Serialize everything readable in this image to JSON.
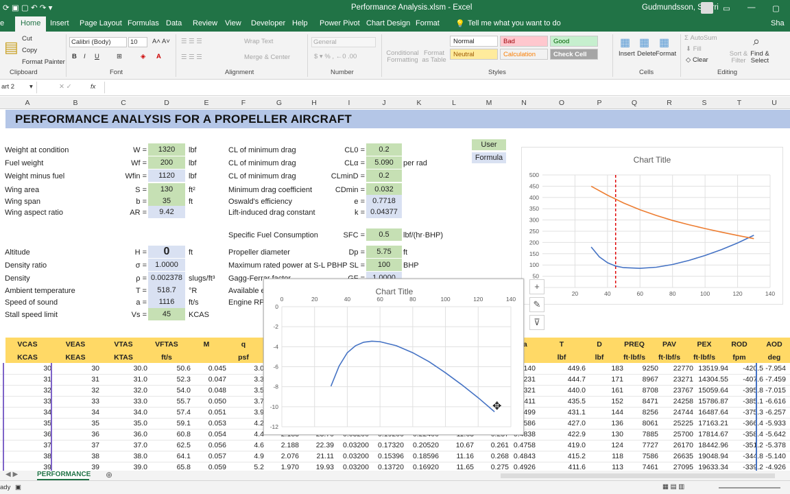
{
  "window": {
    "title": "Performance Analysis.xlsm  -  Excel",
    "user": "Gudmundsson, Snorri"
  },
  "tabs": [
    "Home",
    "Insert",
    "Page Layout",
    "Formulas",
    "Data",
    "Review",
    "View",
    "Developer",
    "Help",
    "Power Pivot",
    "Chart Design",
    "Format"
  ],
  "tell_me": "Tell me what you want to do",
  "share": "Sha",
  "ribbon": {
    "clipboard": {
      "cut": "Cut",
      "copy": "Copy",
      "painter": "Format Painter",
      "group": "Clipboard"
    },
    "font": {
      "name": "Calibri (Body)",
      "size": "10",
      "group": "Font"
    },
    "alignment": {
      "wrap": "Wrap Text",
      "merge": "Merge & Center",
      "group": "Alignment"
    },
    "number": {
      "format": "General",
      "group": "Number"
    },
    "styles": {
      "cond": "Conditional Formatting",
      "table": "Format as Table",
      "normal": "Normal",
      "bad": "Bad",
      "good": "Good",
      "neutral": "Neutral",
      "calc": "Calculation",
      "check": "Check Cell",
      "group": "Styles"
    },
    "cells": {
      "insert": "Insert",
      "delete": "Delete",
      "format": "Format",
      "group": "Cells"
    },
    "editing": {
      "autosum": "AutoSum",
      "fill": "Fill",
      "clear": "Clear",
      "sort": "Sort & Filter",
      "find": "Find & Select",
      "group": "Editing"
    }
  },
  "namebox": "art 2",
  "fx": "fx",
  "columns": [
    "A",
    "B",
    "C",
    "D",
    "E",
    "F",
    "G",
    "H",
    "I",
    "J",
    "K",
    "L",
    "M",
    "N",
    "O",
    "P",
    "Q",
    "R",
    "S",
    "T",
    "U"
  ],
  "banner": "PERFORMANCE ANALYSIS FOR A PROPELLER AIRCRAFT",
  "params_left": [
    {
      "label": "Weight at condition",
      "sym": "W =",
      "val": "1320",
      "unit": "lbf",
      "cls": "in"
    },
    {
      "label": "Fuel weight",
      "sym": "Wf =",
      "val": "200",
      "unit": "lbf",
      "cls": "in"
    },
    {
      "label": "Weight minus fuel",
      "sym": "Wfin =",
      "val": "1120",
      "unit": "lbf",
      "cls": "fo"
    },
    {
      "label": "Wing area",
      "sym": "S =",
      "val": "130",
      "unit": "ft²",
      "cls": "in"
    },
    {
      "label": "Wing span",
      "sym": "b =",
      "val": "35",
      "unit": "ft",
      "cls": "in"
    },
    {
      "label": "Wing aspect ratio",
      "sym": "AR =",
      "val": "9.42",
      "unit": "",
      "cls": "fo"
    }
  ],
  "params_left2": [
    {
      "label": "Altitude",
      "sym": "H =",
      "val": "0",
      "unit": "ft",
      "cls": "fo"
    },
    {
      "label": "Density ratio",
      "sym": "σ =",
      "val": "1.0000",
      "unit": "",
      "cls": "fo"
    },
    {
      "label": "Density",
      "sym": "ρ =",
      "val": "0.002378",
      "unit": "slugs/ft³",
      "cls": "fo"
    },
    {
      "label": "Ambient temperature",
      "sym": "T =",
      "val": "518.7",
      "unit": "°R",
      "cls": "fo"
    },
    {
      "label": "Speed of sound",
      "sym": "a =",
      "val": "1116",
      "unit": "ft/s",
      "cls": "fo"
    },
    {
      "label": "Stall speed limit",
      "sym": "Vs =",
      "val": "45",
      "unit": "KCAS",
      "cls": "in"
    }
  ],
  "params_mid": [
    {
      "label": "CL of minimum drag",
      "sym": "CL0 =",
      "val": "0.2",
      "unit": "",
      "cls": "in"
    },
    {
      "label": "CL of minimum drag",
      "sym": "CLα =",
      "val": "5.090",
      "unit": "per rad",
      "cls": "in"
    },
    {
      "label": "CL of minimum drag",
      "sym": "CLminD =",
      "val": "0.2",
      "unit": "",
      "cls": "in"
    },
    {
      "label": "Minimum drag coefficient",
      "sym": "CDmin =",
      "val": "0.032",
      "unit": "",
      "cls": "in"
    },
    {
      "label": "Oswald's efficiency",
      "sym": "e =",
      "val": "0.7718",
      "unit": "",
      "cls": "fo"
    },
    {
      "label": "Lift-induced drag constant",
      "sym": "k =",
      "val": "0.04377",
      "unit": "",
      "cls": "fo"
    }
  ],
  "params_mid2": [
    {
      "label": "Specific Fuel Consumption",
      "sym": "SFC =",
      "val": "0.5",
      "unit": "lbf/(hr·BHP)",
      "cls": "in"
    },
    {
      "label": "Propeller diameter",
      "sym": "Dp =",
      "val": "5.75",
      "unit": "ft",
      "cls": "in"
    },
    {
      "label": "Maximum rated power at S-L",
      "sym": "PBHP SL =",
      "val": "100",
      "unit": "BHP",
      "cls": "in"
    },
    {
      "label": "Gagg-Ferrar factor",
      "sym": "GF =",
      "val": "1.0000",
      "unit": "",
      "cls": "fo"
    },
    {
      "label": "Available e",
      "sym": "",
      "val": "",
      "unit": "",
      "cls": ""
    },
    {
      "label": "Engine RPM",
      "sym": "",
      "val": "",
      "unit": "",
      "cls": ""
    }
  ],
  "legend": {
    "user": "User",
    "formula": "Formula"
  },
  "headers_top": [
    "VCAS",
    "VEAS",
    "VTAS",
    "VFTAS",
    "M",
    "q",
    "ta",
    "T",
    "D",
    "PREQ",
    "PAV",
    "PEX",
    "ROD",
    "AOD"
  ],
  "headers_unit": [
    "KCAS",
    "KEAS",
    "KTAS",
    "ft/s",
    "",
    "psf",
    "",
    "lbf",
    "lbf",
    "ft·lbf/s",
    "ft·lbf/s",
    "ft·lbf/s",
    "fpm",
    "deg"
  ],
  "rows": [
    [
      "30",
      "30",
      "30.0",
      "50.6",
      "0.045",
      "3.0",
      "",
      "",
      "",
      "",
      "",
      "",
      "",
      "140",
      "449.6",
      "183",
      "9250",
      "22770",
      "13519.94",
      "-420.5",
      "-7.954"
    ],
    [
      "31",
      "31",
      "31.0",
      "52.3",
      "0.047",
      "3.3",
      "",
      "",
      "",
      "",
      "",
      "",
      "",
      "231",
      "444.7",
      "171",
      "8967",
      "23271",
      "14304.55",
      "-407.6",
      "-7.459"
    ],
    [
      "32",
      "32",
      "32.0",
      "54.0",
      "0.048",
      "3.5",
      "",
      "",
      "",
      "",
      "",
      "",
      "",
      "321",
      "440.0",
      "161",
      "8708",
      "23767",
      "15059.64",
      "-395.8",
      "-7.015"
    ],
    [
      "33",
      "33",
      "33.0",
      "55.7",
      "0.050",
      "3.7",
      "",
      "",
      "",
      "",
      "",
      "",
      "",
      "411",
      "435.5",
      "152",
      "8471",
      "24258",
      "15786.87",
      "-385.1",
      "-6.616"
    ],
    [
      "34",
      "34",
      "34.0",
      "57.4",
      "0.051",
      "3.9",
      "",
      "",
      "",
      "",
      "",
      "",
      "",
      "499",
      "431.1",
      "144",
      "8256",
      "24744",
      "16487.64",
      "-375.3",
      "-6.257"
    ],
    [
      "35",
      "35",
      "35.0",
      "59.1",
      "0.053",
      "4.2",
      "",
      "",
      "",
      "",
      "",
      "",
      "",
      "586",
      "427.0",
      "136",
      "8061",
      "25225",
      "17163.21",
      "-366.4",
      "-5.933"
    ],
    [
      "36",
      "36",
      "36.0",
      "60.8",
      "0.054",
      "4.4",
      "2.183",
      "23.70",
      "0.03200",
      "0.19200",
      "0.22400",
      "11.63",
      "0.257",
      "0.4838",
      "422.9",
      "130",
      "7885",
      "25700",
      "17814.67",
      "-358.4",
      "-5.642"
    ],
    [
      "37",
      "37",
      "37.0",
      "62.5",
      "0.056",
      "4.6",
      "2.188",
      "22.39",
      "0.03200",
      "0.17320",
      "0.20520",
      "10.67",
      "0.261",
      "0.4758",
      "419.0",
      "124",
      "7727",
      "26170",
      "18442.96",
      "-351.2",
      "-5.378"
    ],
    [
      "38",
      "38",
      "38.0",
      "64.1",
      "0.057",
      "4.9",
      "2.076",
      "21.11",
      "0.03200",
      "0.15396",
      "0.18596",
      "11.16",
      "0.268",
      "0.4843",
      "415.2",
      "118",
      "7586",
      "26635",
      "19048.94",
      "-344.8",
      "-5.140"
    ],
    [
      "39",
      "39",
      "39.0",
      "65.8",
      "0.059",
      "5.2",
      "1.970",
      "19.93",
      "0.03200",
      "0.13720",
      "0.16920",
      "11.65",
      "0.275",
      "0.4926",
      "411.6",
      "113",
      "7461",
      "27095",
      "19633.34",
      "-339.2",
      "-4.926"
    ]
  ],
  "chart2": {
    "title": "Chart Title"
  },
  "chart1": {
    "title": "Chart Title"
  },
  "chart_data": [
    {
      "type": "line",
      "title": "Chart Title",
      "xlim": [
        0,
        140
      ],
      "ylim": [
        -12,
        0
      ],
      "x_ticks": [
        0,
        20,
        40,
        60,
        80,
        100,
        120,
        140
      ],
      "y_ticks": [
        0,
        -2,
        -4,
        -6,
        -8,
        -10,
        -12
      ],
      "series": [
        {
          "color": "#4472c4",
          "x": [
            30,
            35,
            40,
            45,
            50,
            55,
            60,
            70,
            80,
            90,
            100,
            110,
            120,
            130
          ],
          "y": [
            -7.95,
            -5.93,
            -4.6,
            -3.9,
            -3.55,
            -3.45,
            -3.5,
            -3.9,
            -4.6,
            -5.5,
            -6.6,
            -7.8,
            -9.1,
            -10.5
          ]
        }
      ]
    },
    {
      "type": "line",
      "title": "Chart Title",
      "xlim": [
        0,
        140
      ],
      "ylim": [
        0,
        500
      ],
      "x_ticks": [
        20,
        40,
        60,
        80,
        100,
        120,
        140
      ],
      "y_ticks": [
        0,
        50,
        100,
        150,
        200,
        250,
        300,
        350,
        400,
        450,
        500
      ],
      "vline_x": 45,
      "series": [
        {
          "color": "#4472c4",
          "x": [
            30,
            35,
            40,
            45,
            50,
            60,
            70,
            80,
            90,
            100,
            110,
            120,
            130
          ],
          "y": [
            180,
            136,
            110,
            95,
            88,
            85,
            90,
            102,
            120,
            142,
            168,
            198,
            232
          ]
        },
        {
          "color": "#ed7d31",
          "x": [
            30,
            40,
            50,
            60,
            70,
            80,
            90,
            100,
            110,
            120,
            130
          ],
          "y": [
            450,
            410,
            375,
            345,
            320,
            298,
            279,
            262,
            246,
            231,
            217
          ]
        }
      ]
    }
  ],
  "sheet": {
    "name": "PERFORMANCE",
    "status": "ady"
  }
}
